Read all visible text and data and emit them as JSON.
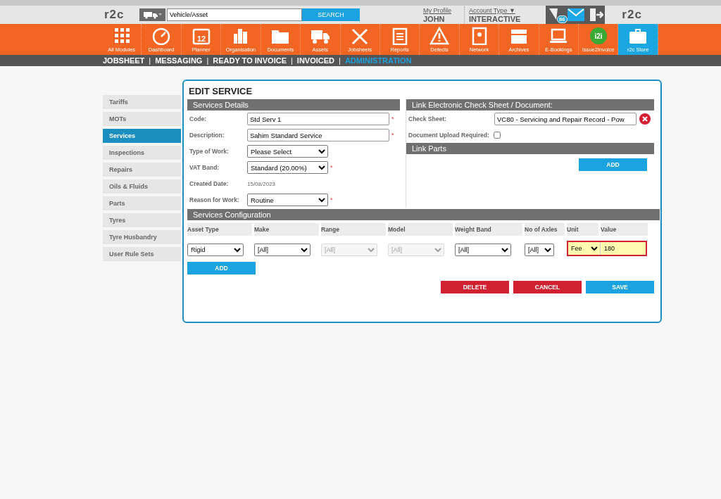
{
  "header": {
    "logo": "r2c",
    "search": {
      "value": "Vehicle/Asset",
      "button": "SEARCH"
    },
    "profile": {
      "link": "My Profile",
      "name": "JOHN"
    },
    "account": {
      "link": "Account Type",
      "caret": "▼",
      "value": "INTERACTIVE"
    },
    "alerts_badge": "86",
    "right_logo": "r2c"
  },
  "modules": [
    {
      "label": "All Modules",
      "kind": "grid",
      "selected": false
    },
    {
      "label": "Dashboard",
      "kind": "gauge",
      "selected": false
    },
    {
      "label": "Planner",
      "kind": "calendar",
      "icon_text": "12",
      "selected": false
    },
    {
      "label": "Organisation",
      "kind": "buildings",
      "selected": false
    },
    {
      "label": "Documents",
      "kind": "folder",
      "selected": false
    },
    {
      "label": "Assets",
      "kind": "truck",
      "selected": false
    },
    {
      "label": "Jobsheets",
      "kind": "tools",
      "selected": false
    },
    {
      "label": "Reports",
      "kind": "clipboard",
      "selected": false
    },
    {
      "label": "Defects",
      "kind": "warning",
      "selected": false
    },
    {
      "label": "Network",
      "kind": "book",
      "selected": false
    },
    {
      "label": "Archives",
      "kind": "drawer",
      "selected": false
    },
    {
      "label": "E-Bookings",
      "kind": "laptop",
      "selected": false
    },
    {
      "label": "Issue2Invoice",
      "kind": "badge",
      "icon_text": "i2i",
      "selected": false
    },
    {
      "label": "r2c Store",
      "kind": "briefcase",
      "selected": true
    }
  ],
  "subnav": [
    {
      "label": "JOBSHEET",
      "selected": false
    },
    {
      "separator": "|",
      "label": "MESSAGING",
      "selected": false
    },
    {
      "separator": "|",
      "label": "READY TO INVOICE",
      "selected": false
    },
    {
      "separator": "|",
      "label": "INVOICED",
      "selected": false
    },
    {
      "separator": "|",
      "label": "ADMINISTRATION",
      "selected": true
    }
  ],
  "sidebar": {
    "items": [
      {
        "label": "Tariffs",
        "selected": false
      },
      {
        "label": "MOTs",
        "selected": false
      },
      {
        "label": "Services",
        "selected": true
      },
      {
        "label": "Inspections",
        "selected": false
      },
      {
        "label": "Repairs",
        "selected": false
      },
      {
        "label": "Oils & Fluids",
        "selected": false
      },
      {
        "label": "Parts",
        "selected": false
      },
      {
        "label": "Tyres",
        "selected": false
      },
      {
        "label": "Tyre Husbandry",
        "selected": false
      },
      {
        "label": "User Rule Sets",
        "selected": false
      }
    ]
  },
  "form": {
    "title": "EDIT SERVICE",
    "details": {
      "heading": "Services Details",
      "fields": [
        {
          "label": "Code:",
          "kind": "text",
          "value": "Std Serv 1",
          "required_mark": "*"
        },
        {
          "label": "Description:",
          "kind": "text",
          "value": "Sahim Standard Service",
          "required_mark": "*"
        },
        {
          "label": "Type of Work:",
          "kind": "select",
          "value": "Please Select"
        },
        {
          "label": "VAT Band:",
          "kind": "select",
          "value": "Standard (20.00%)",
          "required_mark": "*"
        },
        {
          "label": "Created Date:",
          "kind": "static",
          "value": "15/08/2023"
        },
        {
          "label": "Reason for Work:",
          "kind": "select",
          "value": "Routine",
          "required_mark": "*"
        }
      ]
    },
    "check_sheet": {
      "heading": "Link Electronic Check Sheet / Document:",
      "label": "Check Sheet:",
      "value": "VC80 - Servicing and Repair Record - Pow",
      "upload_label": "Document Upload Required:",
      "upload_checked": false
    },
    "link_parts": {
      "heading": "Link Parts",
      "button": "ADD"
    },
    "configuration": {
      "heading": "Services Configuration",
      "columns": [
        "Asset Type",
        "Make",
        "Range",
        "Model",
        "Weight Band",
        "No of Axles",
        "Unit",
        "Value"
      ],
      "row": [
        {
          "value": "Rigid",
          "kind": "select",
          "disabled": false,
          "highlighted": false
        },
        {
          "value": "[All]",
          "kind": "select",
          "disabled": false,
          "highlighted": false
        },
        {
          "value": "[All]",
          "kind": "select",
          "disabled": true,
          "highlighted": false
        },
        {
          "value": "[All]",
          "kind": "select",
          "disabled": true,
          "highlighted": false
        },
        {
          "value": "[All]",
          "kind": "select",
          "disabled": false,
          "highlighted": false
        },
        {
          "value": "[All]",
          "kind": "select",
          "disabled": false,
          "highlighted": false
        },
        {
          "value": "Fee",
          "kind": "select",
          "disabled": false,
          "highlighted": true
        },
        {
          "value": "180",
          "kind": "text",
          "disabled": false,
          "highlighted": true
        }
      ],
      "button": "ADD"
    },
    "actions": [
      {
        "label": "DELETE",
        "kind": "danger"
      },
      {
        "label": "CANCEL",
        "kind": "danger"
      },
      {
        "label": "SAVE",
        "kind": "primary"
      }
    ]
  }
}
